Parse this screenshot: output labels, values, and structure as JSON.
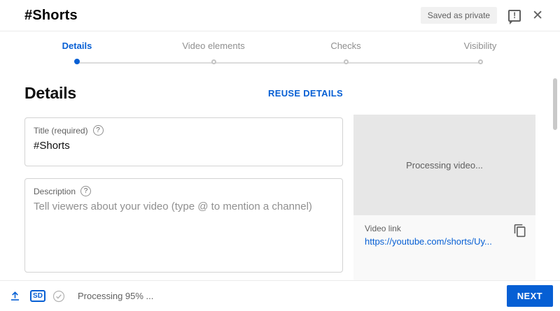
{
  "colors": {
    "accent_blue": "#065fd4",
    "processing_box_bg": "#e7e7e7",
    "link_card_bg": "#f9f9f9",
    "badge_bg": "#f1f1f1",
    "text_secondary": "#606060"
  },
  "header": {
    "title": "#Shorts",
    "status_badge": "Saved as private"
  },
  "glyphs": {
    "help": "?",
    "feedback": "!",
    "close": "✕"
  },
  "stepper": {
    "steps": [
      {
        "label": "Details",
        "state": "active"
      },
      {
        "label": "Video elements",
        "state": "upcoming"
      },
      {
        "label": "Checks",
        "state": "upcoming"
      },
      {
        "label": "Visibility",
        "state": "upcoming"
      }
    ]
  },
  "details_section": {
    "heading": "Details",
    "reuse_details_label": "REUSE DETAILS",
    "title_field": {
      "label": "Title (required)",
      "value": "#Shorts"
    },
    "description_field": {
      "label": "Description",
      "placeholder": "Tell viewers about your video (type @ to mention a channel)"
    }
  },
  "preview_panel": {
    "processing_text": "Processing video...",
    "video_link_label": "Video link",
    "video_link_url": "https://youtube.com/shorts/Uy..."
  },
  "footer": {
    "quality_badge": "SD",
    "processing_status": "Processing 95% ...",
    "next_label": "NEXT"
  }
}
